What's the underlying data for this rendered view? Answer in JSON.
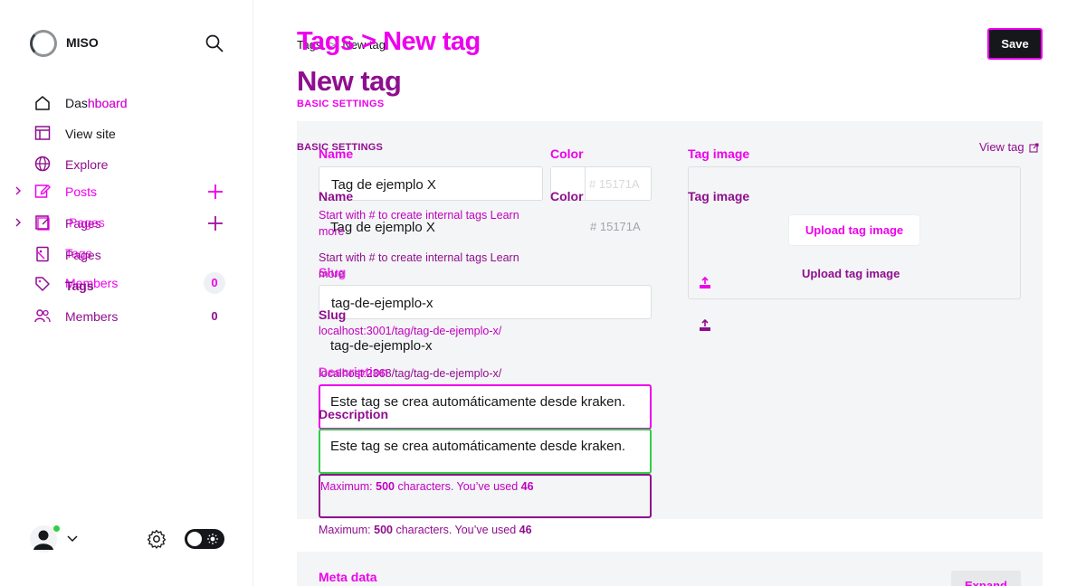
{
  "sidebar": {
    "brand": "MISO",
    "nav": [
      {
        "label": "Dashboard",
        "icon": "home-icon"
      },
      {
        "label": "View site",
        "icon": "window-icon"
      },
      {
        "label": "Explore",
        "icon": "globe-icon"
      }
    ],
    "nav_overlay": {
      "dashboard_fragment": "hboard"
    },
    "sections": {
      "posts": "Posts",
      "pages": "Pages",
      "pages_ghost": "Pages",
      "pages_ghost2": "Pages",
      "tags": "Tags",
      "tags_ghost": "Tags",
      "members": "Members",
      "members_ghost": "Members",
      "members_count": "0",
      "members_count_ghost": "0"
    }
  },
  "header": {
    "breadcrumb_parent": "Tags",
    "breadcrumb_sep": ">",
    "breadcrumb_current": "New tag",
    "breadcrumb_ghost": "Tags > New tag",
    "title": "New tag",
    "section_label": "BASIC SETTINGS",
    "section_label_ghost": "BASIC SETTINGS",
    "save_label": "Save"
  },
  "form": {
    "name_label": "Name",
    "name_value": "Tag de ejemplo X",
    "name_help": "Start with # to create internal tags Learn more",
    "color_label": "Color",
    "color_hash": "#",
    "color_value": "15171A",
    "slug_label": "Slug",
    "slug_value": "tag-de-ejemplo-x",
    "slug_url_a": "localhost:3001/tag/tag-de-ejemplo-x/",
    "slug_url_b": "localhost:2368/tag/tag-de-ejemplo-x/",
    "description_label": "Description",
    "description_value": "Este tag se crea automáticamente desde kraken.",
    "desc_help_prefix": "Maximum: ",
    "desc_help_max": "500",
    "desc_help_mid": " characters. You’ve used ",
    "desc_help_used": "46"
  },
  "image": {
    "label": "Tag image",
    "upload_label": "Upload tag image",
    "view_tag_label": "View tag"
  },
  "meta": {
    "label": "Meta data",
    "expand_label": "Expand"
  },
  "colors": {
    "overlay": "#ee00ee",
    "purple": "#8f0e8f",
    "accent_green": "#30cf43",
    "panel": "#f4f5f6"
  }
}
